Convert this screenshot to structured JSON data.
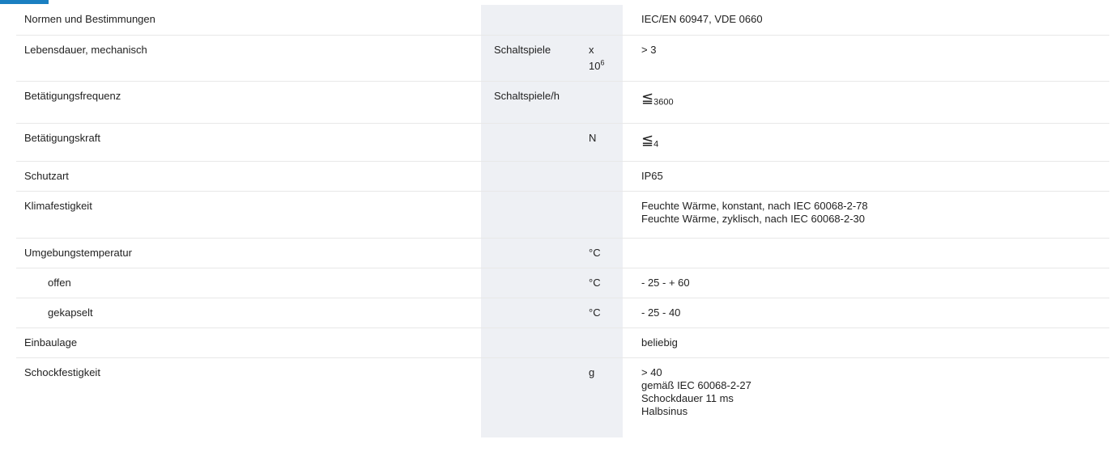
{
  "rows": [
    {
      "label": "Normen und Bestimmungen",
      "unit1": "",
      "unit2": "",
      "value": "IEC/EN 60947, VDE 0660"
    },
    {
      "label": "Lebensdauer, mechanisch",
      "unit1": "Schaltspiele",
      "unit2_prefix": "x",
      "unit2_base": "10",
      "unit2_exp": "6",
      "value": "> 3"
    },
    {
      "label": "Betätigungsfrequenz",
      "unit1": "Schaltspiele/h",
      "unit2": "",
      "value_symbol": "≦",
      "value_sub": "3600"
    },
    {
      "label": "Betätigungskraft",
      "unit1": "",
      "unit2": "N",
      "value_symbol": "≦",
      "value_sub": "4"
    },
    {
      "label": "Schutzart",
      "unit1": "",
      "unit2": "",
      "value": "IP65"
    },
    {
      "label": "Klimafestigkeit",
      "unit1": "",
      "unit2": "",
      "value_lines": [
        "Feuchte Wärme, konstant, nach IEC 60068-2-78",
        "Feuchte Wärme, zyklisch, nach IEC 60068-2-30"
      ]
    },
    {
      "label": "Umgebungstemperatur",
      "unit1": "",
      "unit2": "°C",
      "value": ""
    },
    {
      "label": "offen",
      "unit1": "",
      "unit2": "°C",
      "value": "- 25 - + 60"
    },
    {
      "label": "gekapselt",
      "unit1": "",
      "unit2": "°C",
      "value": "- 25 - 40"
    },
    {
      "label": "Einbaulage",
      "unit1": "",
      "unit2": "",
      "value": "beliebig"
    },
    {
      "label": "Schockfestigkeit",
      "unit1": "",
      "unit2": "g",
      "value_lines": [
        "> 40",
        "gemäß IEC 60068-2-27",
        "Schockdauer 11 ms",
        "Halbsinus"
      ]
    }
  ],
  "colors": {
    "accent": "#1a7fc1",
    "unit_column_bg": "#eef0f4",
    "row_divider": "#e8e8e8"
  }
}
